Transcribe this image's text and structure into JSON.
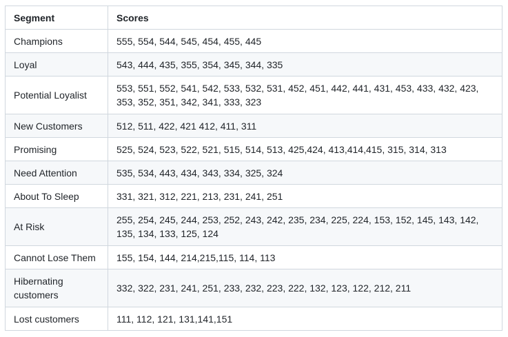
{
  "table": {
    "headers": [
      "Segment",
      "Scores"
    ],
    "rows": [
      {
        "segment": "Champions",
        "scores": "555, 554, 544, 545, 454, 455, 445"
      },
      {
        "segment": "Loyal",
        "scores": "543, 444, 435, 355, 354, 345, 344, 335"
      },
      {
        "segment": "Potential Loyalist",
        "scores": "553, 551, 552, 541, 542, 533, 532, 531, 452, 451, 442, 441, 431, 453, 433, 432, 423, 353, 352, 351, 342, 341, 333, 323"
      },
      {
        "segment": "New Customers",
        "scores": "512, 511, 422, 421 412, 411, 311"
      },
      {
        "segment": "Promising",
        "scores": "525, 524, 523, 522, 521, 515, 514, 513, 425,424, 413,414,415, 315, 314, 313"
      },
      {
        "segment": "Need Attention",
        "scores": "535, 534, 443, 434, 343, 334, 325, 324"
      },
      {
        "segment": "About To Sleep",
        "scores": "331, 321, 312, 221, 213, 231, 241, 251"
      },
      {
        "segment": "At Risk",
        "scores": "255, 254, 245, 244, 253, 252, 243, 242, 235, 234, 225, 224, 153, 152, 145, 143, 142, 135, 134, 133, 125, 124"
      },
      {
        "segment": "Cannot Lose Them",
        "scores": "155, 154, 144, 214,215,115, 114, 113"
      },
      {
        "segment": "Hibernating customers",
        "scores": "332, 322, 231, 241, 251, 233, 232, 223, 222, 132, 123, 122, 212, 211"
      },
      {
        "segment": "Lost customers",
        "scores": "111, 112, 121, 131,141,151"
      }
    ]
  }
}
